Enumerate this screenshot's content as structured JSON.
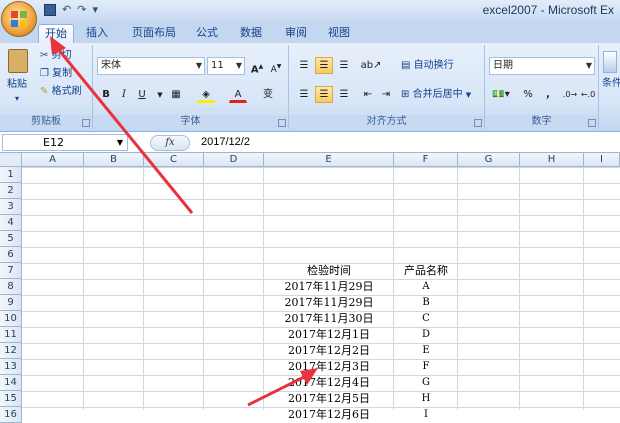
{
  "window": {
    "title": "excel2007 - Microsoft Ex"
  },
  "quick_access": {
    "save_icon": "save-icon",
    "undo": "↶",
    "redo": "↷",
    "customize": "▾"
  },
  "tabs": [
    "开始",
    "插入",
    "页面布局",
    "公式",
    "数据",
    "审阅",
    "视图"
  ],
  "clipboard": {
    "paste_label": "粘贴",
    "cut_label": "剪切",
    "copy_label": "复制",
    "format_painter_label": "格式刷",
    "group_label": "剪贴板"
  },
  "font": {
    "font_name": "宋体",
    "font_size": "11",
    "grow": "A",
    "shrink": "A",
    "bold": "B",
    "italic": "I",
    "underline": "U",
    "font_color_glyph": "A",
    "phonetic_glyph": "变",
    "group_label": "字体"
  },
  "alignment": {
    "wrap_label": "自动换行",
    "merge_label": "合并后居中",
    "group_label": "对齐方式"
  },
  "number": {
    "format": "日期",
    "percent": "%",
    "comma": ",",
    "group_label": "数字"
  },
  "styles": {
    "partial_label": "条件"
  },
  "formula_bar": {
    "name_box": "E12",
    "fx": "fx",
    "value": "2017/12/2"
  },
  "columns": [
    "A",
    "B",
    "C",
    "D",
    "E",
    "F",
    "G",
    "H",
    "I"
  ],
  "rows": [
    "1",
    "2",
    "3",
    "4",
    "5",
    "6",
    "7",
    "8",
    "9",
    "10",
    "11",
    "12",
    "13",
    "14",
    "15",
    "16"
  ],
  "table": {
    "header_date": "检验时间",
    "header_product": "产品名称",
    "rows": [
      {
        "date": "2017年11月29日",
        "product": "A"
      },
      {
        "date": "2017年11月29日",
        "product": "B"
      },
      {
        "date": "2017年11月30日",
        "product": "C"
      },
      {
        "date": "2017年12月1日",
        "product": "D"
      },
      {
        "date": "2017年12月2日",
        "product": "E"
      },
      {
        "date": "2017年12月3日",
        "product": "F"
      },
      {
        "date": "2017年12月4日",
        "product": "G"
      },
      {
        "date": "2017年12月5日",
        "product": "H"
      },
      {
        "date": "2017年12月6日",
        "product": "I"
      }
    ]
  },
  "colors": {
    "annotation": "#e8323c",
    "ribbon_text": "#15428b",
    "selected_button": "#f9c95e"
  }
}
